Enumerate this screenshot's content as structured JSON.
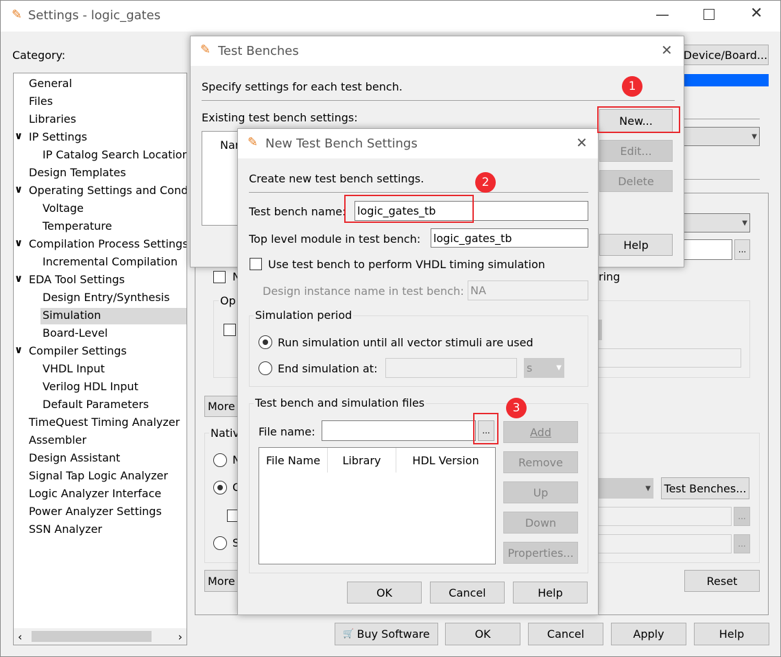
{
  "main": {
    "title": "Settings - logic_gates",
    "category_label": "Category:",
    "tree": [
      {
        "label": "General",
        "level": 0
      },
      {
        "label": "Files",
        "level": 0
      },
      {
        "label": "Libraries",
        "level": 0
      },
      {
        "label": "IP Settings",
        "level": 0,
        "expanded": true
      },
      {
        "label": "IP Catalog Search Location",
        "level": 1
      },
      {
        "label": "Design Templates",
        "level": 0
      },
      {
        "label": "Operating Settings and Conditions",
        "level": 0,
        "expanded": true
      },
      {
        "label": "Voltage",
        "level": 1
      },
      {
        "label": "Temperature",
        "level": 1
      },
      {
        "label": "Compilation Process Settings",
        "level": 0,
        "expanded": true
      },
      {
        "label": "Incremental Compilation",
        "level": 1
      },
      {
        "label": "EDA Tool Settings",
        "level": 0,
        "expanded": true
      },
      {
        "label": "Design Entry/Synthesis",
        "level": 1
      },
      {
        "label": "Simulation",
        "level": 1,
        "selected": true
      },
      {
        "label": "Board-Level",
        "level": 1
      },
      {
        "label": "Compiler Settings",
        "level": 0,
        "expanded": true
      },
      {
        "label": "VHDL Input",
        "level": 1
      },
      {
        "label": "Verilog HDL Input",
        "level": 1
      },
      {
        "label": "Default Parameters",
        "level": 1
      },
      {
        "label": "TimeQuest Timing Analyzer",
        "level": 0
      },
      {
        "label": "Assembler",
        "level": 0
      },
      {
        "label": "Design Assistant",
        "level": 0
      },
      {
        "label": "Signal Tap Logic Analyzer",
        "level": 0
      },
      {
        "label": "Logic Analyzer Interface",
        "level": 0
      },
      {
        "label": "Power Analyzer Settings",
        "level": 0
      },
      {
        "label": "SSN Analyzer",
        "level": 0
      }
    ],
    "device_board_button": "Device/Board...",
    "partial_n": "N",
    "partial_ring": "ring",
    "partial_op": "Op",
    "more_button": "More",
    "partial_native": "Nativ",
    "partial_radio_n": "N",
    "partial_radio_c": "C",
    "partial_radio_s": "S",
    "test_benches_button": "Test Benches...",
    "ellipsis": "...",
    "reset_button": "Reset",
    "buttons": {
      "buy": "Buy Software",
      "ok": "OK",
      "cancel": "Cancel",
      "apply": "Apply",
      "help": "Help"
    },
    "accent": "#0066ff"
  },
  "test_benches": {
    "title": "Test Benches",
    "intro": "Specify settings for each test bench.",
    "existing_label": "Existing test bench settings:",
    "list_header_partial": "Nar",
    "new": "New...",
    "edit": "Edit...",
    "delete": "Delete",
    "help": "Help"
  },
  "new_tb": {
    "title": "New Test Bench Settings",
    "intro": "Create new test bench settings.",
    "name_label": "Test bench name:",
    "name_value": "logic_gates_tb",
    "top_label": "Top level module in test bench:",
    "top_value": "logic_gates_tb",
    "vhdl_timing": "Use test bench to perform VHDL timing simulation",
    "vhdl_timing_checked": false,
    "instance_label": "Design instance name in test bench:",
    "instance_value": "NA",
    "sim_period": "Simulation period",
    "run_all": "Run simulation until all vector stimuli are used",
    "end_at": "End simulation at:",
    "end_value": "",
    "unit": "s",
    "selected_period": "run_all",
    "files_group": "Test bench and simulation files",
    "file_name_label": "File name:",
    "file_name_value": "",
    "browse": "...",
    "columns": [
      "File Name",
      "Library",
      "HDL Version"
    ],
    "add": "Add",
    "remove": "Remove",
    "up": "Up",
    "down": "Down",
    "properties": "Properties...",
    "ok": "OK",
    "cancel": "Cancel",
    "help": "Help"
  },
  "annotations": [
    "1",
    "2",
    "3"
  ],
  "annotation_color": "#e8282d"
}
